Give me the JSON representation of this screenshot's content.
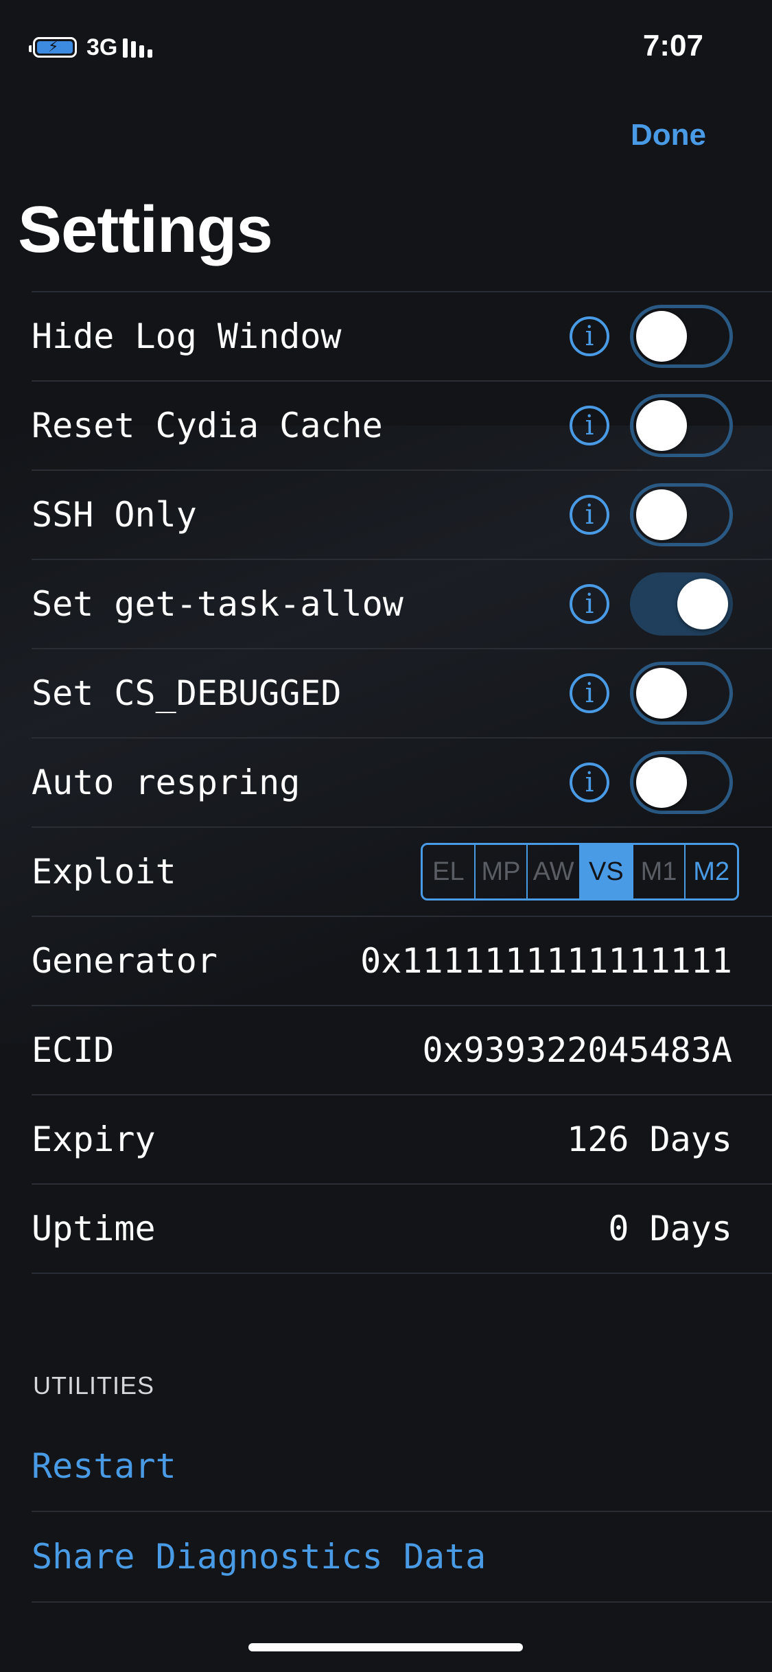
{
  "status_bar": {
    "network": "3G",
    "time": "7:07"
  },
  "nav": {
    "done_label": "Done",
    "title": "Settings"
  },
  "settings": {
    "toggles": [
      {
        "label": "Hide Log Window",
        "on": false
      },
      {
        "label": "Reset Cydia Cache",
        "on": false
      },
      {
        "label": "SSH Only",
        "on": false
      },
      {
        "label": "Set get-task-allow",
        "on": true
      },
      {
        "label": "Set CS_DEBUGGED",
        "on": false
      },
      {
        "label": "Auto respring",
        "on": false
      }
    ],
    "exploit": {
      "label": "Exploit",
      "options": [
        "EL",
        "MP",
        "AW",
        "VS",
        "M1",
        "M2"
      ],
      "selected": "VS",
      "enabled": [
        "VS",
        "M2"
      ]
    },
    "info": [
      {
        "label": "Generator",
        "value": "0x1111111111111111"
      },
      {
        "label": "ECID",
        "value": "0x939322045483A"
      },
      {
        "label": "Expiry",
        "value": "126 Days"
      },
      {
        "label": "Uptime",
        "value": "0 Days"
      }
    ]
  },
  "utilities": {
    "header": "UTILITIES",
    "items": [
      "Restart",
      "Share Diagnostics Data"
    ]
  },
  "colors": {
    "accent": "#4a9be6",
    "background": "#121418",
    "toggle_on": "#1f3f5c"
  },
  "icons": {
    "info": "info-circle-icon",
    "battery": "battery-charging-icon",
    "signal": "signal-bars-icon"
  }
}
